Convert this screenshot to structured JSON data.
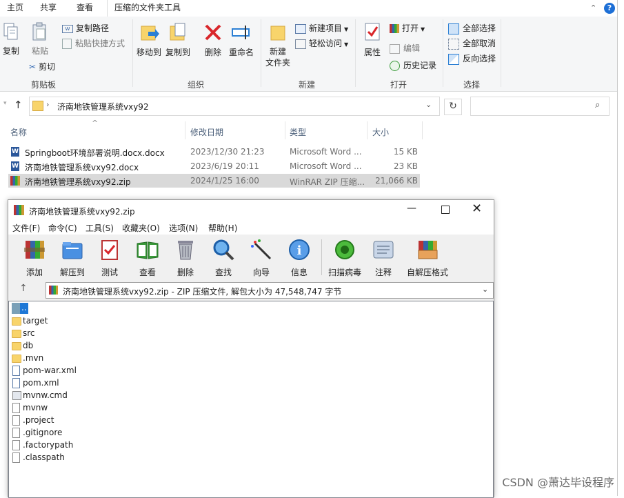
{
  "explorer": {
    "tabs": [
      "主页",
      "共享",
      "查看",
      "压缩的文件夹工具"
    ],
    "ribbon": {
      "clipboard": {
        "group": "剪贴板",
        "copy": "复制",
        "paste": "粘贴",
        "copy_path": "复制路径",
        "paste_shortcut": "粘贴快捷方式",
        "cut": "剪切"
      },
      "organize": {
        "group": "组织",
        "move_to": "移动到",
        "copy_to": "复制到",
        "delete": "删除",
        "rename": "重命名"
      },
      "new": {
        "group": "新建",
        "new_folder_1": "新建",
        "new_folder_2": "文件夹",
        "new_item": "新建项目",
        "easy_access": "轻松访问"
      },
      "open": {
        "group": "打开",
        "properties": "属性",
        "open": "打开",
        "edit": "编辑",
        "history": "历史记录"
      },
      "select": {
        "group": "选择",
        "select_all": "全部选择",
        "select_none": "全部取消",
        "invert": "反向选择"
      }
    },
    "address": {
      "path": "济南地铁管理系统vxy92"
    },
    "columns": {
      "name": "名称",
      "date": "修改日期",
      "type": "类型",
      "size": "大小"
    },
    "files": [
      {
        "name": "Springboot环境部署说明.docx.docx",
        "date": "2023/12/30 21:23",
        "type": "Microsoft Word ...",
        "size": "15 KB",
        "icon": "word-doc-icon"
      },
      {
        "name": "济南地铁管理系统vxy92.docx",
        "date": "2023/6/19 20:11",
        "type": "Microsoft Word ...",
        "size": "23 KB",
        "icon": "word-doc-icon"
      },
      {
        "name": "济南地铁管理系统vxy92.zip",
        "date": "2024/1/25 16:00",
        "type": "WinRAR ZIP 压缩...",
        "size": "21,066 KB",
        "icon": "winrar-zip-icon",
        "selected": true
      }
    ]
  },
  "winrar": {
    "title": "济南地铁管理系统vxy92.zip",
    "menu": [
      "文件(F)",
      "命令(C)",
      "工具(S)",
      "收藏夹(O)",
      "选项(N)",
      "帮助(H)"
    ],
    "toolbar": [
      {
        "label": "添加",
        "icon": "add-icon"
      },
      {
        "label": "解压到",
        "icon": "extract-to-icon"
      },
      {
        "label": "测试",
        "icon": "test-icon"
      },
      {
        "label": "查看",
        "icon": "view-icon"
      },
      {
        "label": "删除",
        "icon": "delete-icon"
      },
      {
        "label": "查找",
        "icon": "find-icon"
      },
      {
        "label": "向导",
        "icon": "wizard-icon"
      },
      {
        "label": "信息",
        "icon": "info-icon"
      },
      {
        "label": "扫描病毒",
        "icon": "virus-scan-icon"
      },
      {
        "label": "注释",
        "icon": "comment-icon"
      },
      {
        "label": "自解压格式",
        "icon": "sfx-icon"
      }
    ],
    "path": "济南地铁管理系统vxy92.zip - ZIP 压缩文件, 解包大小为 47,548,747 字节",
    "entries": [
      {
        "name": "..",
        "kind": "up"
      },
      {
        "name": "target",
        "kind": "folder"
      },
      {
        "name": "src",
        "kind": "folder"
      },
      {
        "name": "db",
        "kind": "folder"
      },
      {
        "name": ".mvn",
        "kind": "folder"
      },
      {
        "name": "pom-war.xml",
        "kind": "xml"
      },
      {
        "name": "pom.xml",
        "kind": "xml"
      },
      {
        "name": "mvnw.cmd",
        "kind": "cmd"
      },
      {
        "name": "mvnw",
        "kind": "file"
      },
      {
        "name": ".project",
        "kind": "file"
      },
      {
        "name": ".gitignore",
        "kind": "file"
      },
      {
        "name": ".factorypath",
        "kind": "file"
      },
      {
        "name": ".classpath",
        "kind": "file"
      }
    ]
  },
  "watermark": "CSDN @萧达毕设程序"
}
